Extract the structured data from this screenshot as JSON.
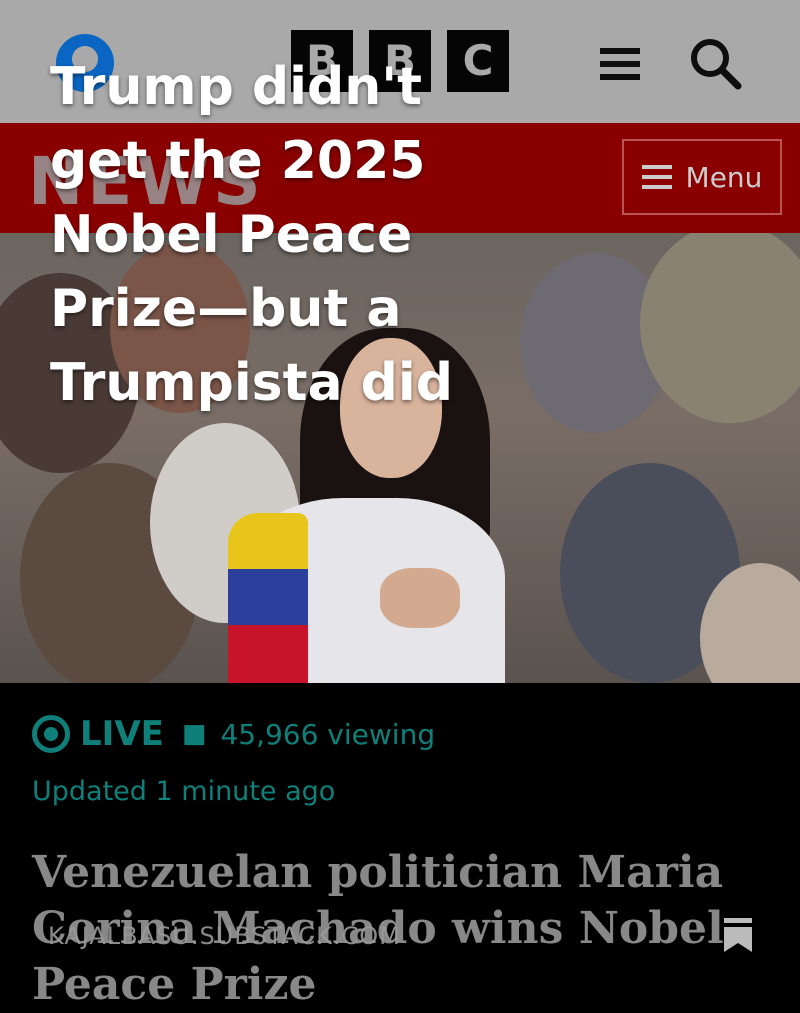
{
  "header": {
    "logo_letters": [
      "B",
      "B",
      "C"
    ],
    "user_icon": "user-circle-icon",
    "menu_icon": "hamburger-icon",
    "search_icon": "search-icon"
  },
  "newsbar": {
    "brand_word": "NEWS",
    "menu_label": "Menu"
  },
  "overlay": {
    "headline": "Trump didn't get the 2025 Nobel Peace Prize—but a Trumpista did"
  },
  "live": {
    "label": "LIVE",
    "viewing": "45,966 viewing",
    "updated": "Updated 1 minute ago"
  },
  "story": {
    "headline": "Venezuelan politician Maria Corina Machado wins Nobel Peace Prize"
  },
  "watermark": "KAJALBASU.SUBSTACK.COM",
  "colors": {
    "topbar": "#a9a9a9",
    "newsbar": "#8a0000",
    "live_teal": "#0f7f7a"
  }
}
